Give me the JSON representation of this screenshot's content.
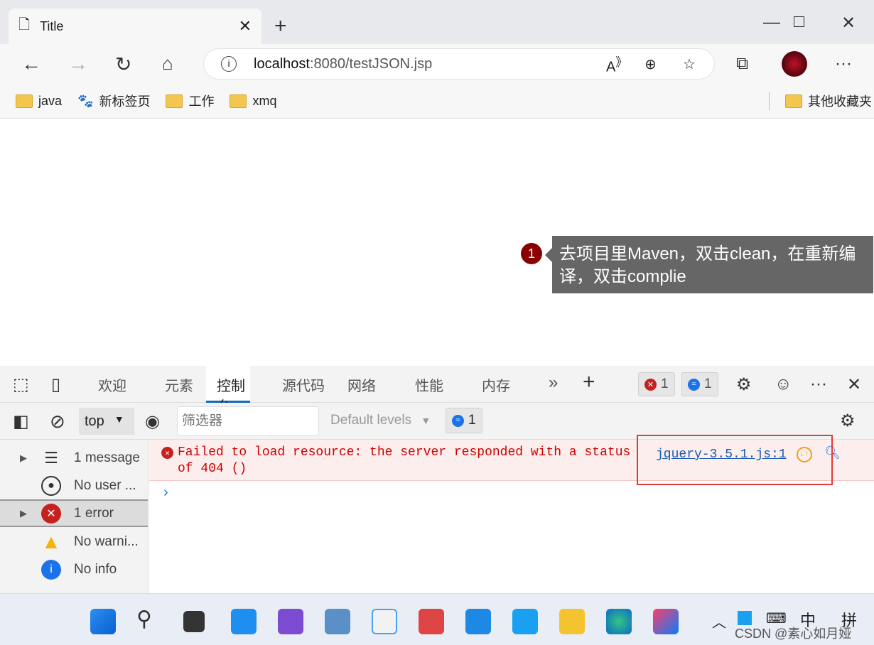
{
  "browser": {
    "tab_title": "Title",
    "url_host": "localhost",
    "url_rest": ":8080/testJSON.jsp"
  },
  "bookmarks": [
    {
      "label": "java"
    },
    {
      "label": "新标签页"
    },
    {
      "label": "工作"
    },
    {
      "label": "xmq"
    }
  ],
  "other_bookmarks": "其他收藏夹",
  "annotation": {
    "number": "1",
    "text": "去项目里Maven，双击clean，在重新编译，双击complie"
  },
  "devtools": {
    "tabs": [
      "欢迎",
      "元素",
      "控制台",
      "源代码",
      "网络",
      "性能",
      "内存"
    ],
    "active_tab": "控制台",
    "error_count": "1",
    "message_count": "1",
    "context": "top",
    "filter_placeholder": "筛选器",
    "levels": "Default levels",
    "issues_count": "1",
    "sidebar": [
      {
        "label": "1 message"
      },
      {
        "label": "No user ..."
      },
      {
        "label": "1 error"
      },
      {
        "label": "No warni..."
      },
      {
        "label": "No info"
      }
    ],
    "error": {
      "line1": "Failed to load resource: the server responded with a status",
      "line2": "of 404 ()",
      "source": "jquery-3.5.1.js:1"
    }
  },
  "taskbar": {
    "ime1": "中",
    "ime2": "拼",
    "watermark": "CSDN @素心如月娅"
  },
  "colors": {
    "error": "#c5221f",
    "accent": "#0f6cbd",
    "highlight_box": "#e53935"
  }
}
